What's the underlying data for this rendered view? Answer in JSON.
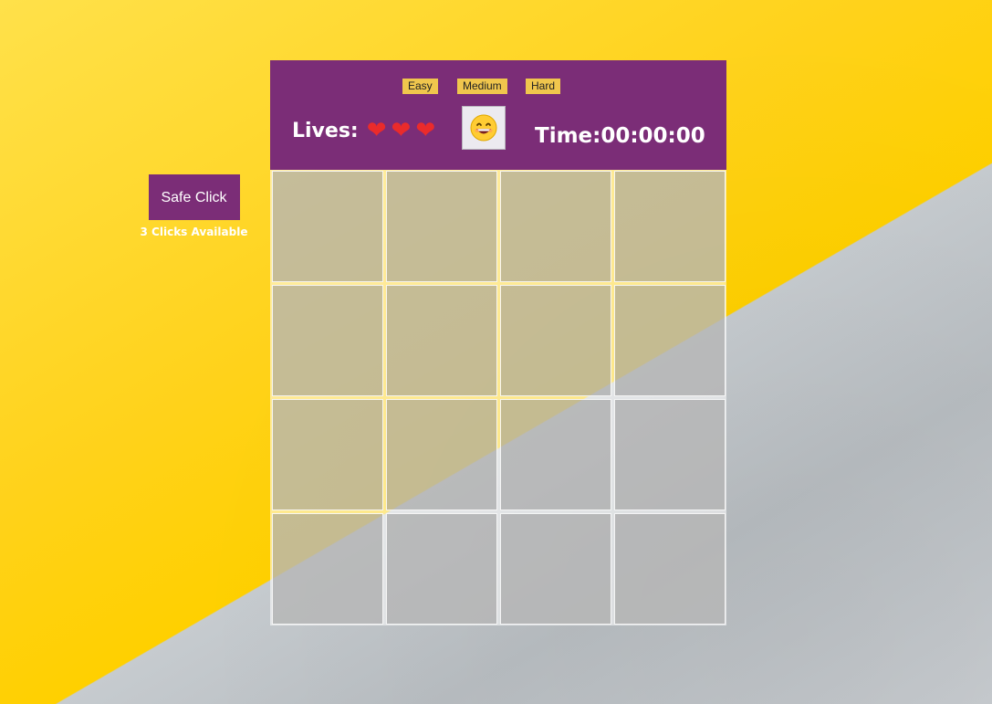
{
  "safe_click": {
    "label": "Safe Click",
    "available": "3 Clicks Available"
  },
  "header": {
    "difficulties": [
      {
        "label": "Easy"
      },
      {
        "label": "Medium"
      },
      {
        "label": "Hard"
      }
    ],
    "lives_label": "Lives:",
    "lives_count": 3,
    "heart_glyph": "❤",
    "timer_label": "Time:",
    "timer_value": "00:00:00",
    "face_icon": "grinning-smiley-icon"
  },
  "board": {
    "rows": 4,
    "cols": 4
  },
  "colors": {
    "accent": "#7b2d77",
    "difficulty_button": "#f0c64d",
    "heart": "#ea2b2b"
  }
}
